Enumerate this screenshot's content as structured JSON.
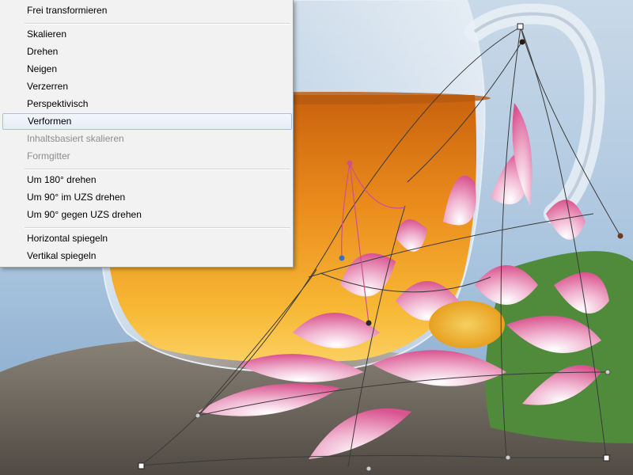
{
  "context_menu": {
    "items": [
      {
        "label": "Frei transformieren",
        "enabled": true
      },
      {
        "label": "Skalieren",
        "enabled": true
      },
      {
        "label": "Drehen",
        "enabled": true
      },
      {
        "label": "Neigen",
        "enabled": true
      },
      {
        "label": "Verzerren",
        "enabled": true
      },
      {
        "label": "Perspektivisch",
        "enabled": true
      },
      {
        "label": "Verformen",
        "enabled": true,
        "highlighted": true
      },
      {
        "label": "Inhaltsbasiert skalieren",
        "enabled": false
      },
      {
        "label": "Formgitter",
        "enabled": false
      },
      {
        "label": "Um 180° drehen",
        "enabled": true
      },
      {
        "label": "Um 90° im UZS drehen",
        "enabled": true
      },
      {
        "label": "Um 90° gegen UZS drehen",
        "enabled": true
      },
      {
        "label": "Horizontal spiegeln",
        "enabled": true
      },
      {
        "label": "Vertikal spiegeln",
        "enabled": true
      }
    ]
  },
  "colors": {
    "menu_background": "#f2f2f2",
    "menu_highlight_border": "#a8c0de",
    "disabled_text": "#8d8d8d",
    "warp_grid_line": "#3a3a3a",
    "warp_handle_pink": "#d0508f",
    "warp_handle_blue": "#3b6fc6",
    "warp_handle_brown": "#6b3a1e"
  }
}
